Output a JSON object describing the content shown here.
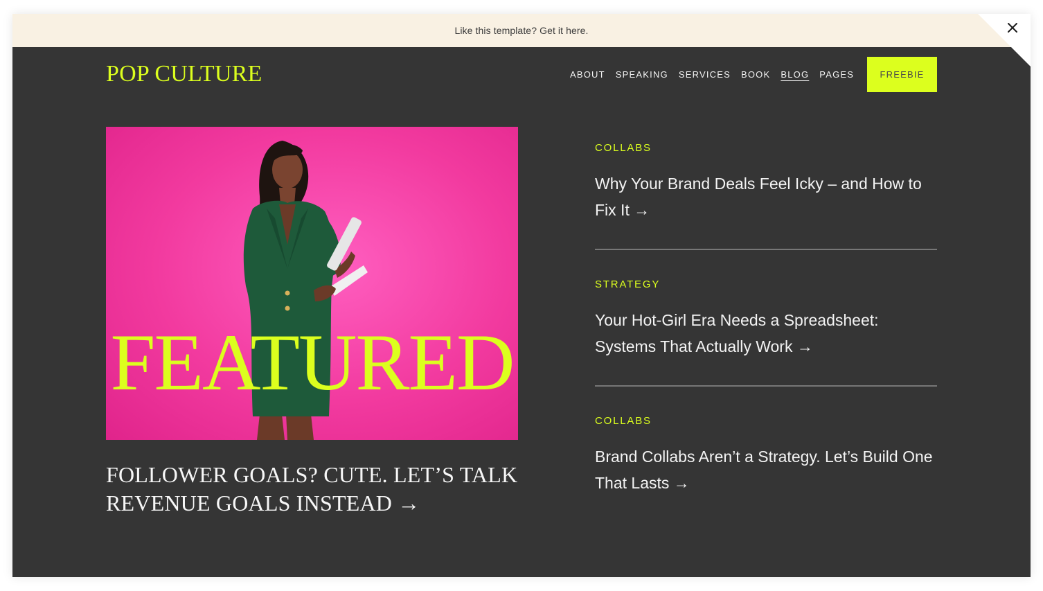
{
  "announcement": {
    "text": "Like this template? Get it here."
  },
  "site": {
    "logo": "POP CULTURE"
  },
  "nav": {
    "items": [
      {
        "label": "ABOUT"
      },
      {
        "label": "SPEAKING"
      },
      {
        "label": "SERVICES"
      },
      {
        "label": "BOOK"
      },
      {
        "label": "BLOG"
      },
      {
        "label": "PAGES"
      }
    ],
    "active": "BLOG",
    "cta_label": "FREEBIE"
  },
  "featured": {
    "overlay_word": "FEATURED",
    "title": "FOLLOWER GOALS? CUTE. LET’S TALK REVENUE GOALS INSTEAD →"
  },
  "posts": [
    {
      "category": "COLLABS",
      "title": "Why Your Brand Deals Feel Icky – and How to Fix It →"
    },
    {
      "category": "STRATEGY",
      "title": "Your Hot-Girl Era Needs a Spreadsheet: Systems That Actually Work →"
    },
    {
      "category": "COLLABS",
      "title": "Brand Collabs Aren’t a Strategy. Let’s Build One That Lasts →"
    }
  ],
  "colors": {
    "background": "#353535",
    "accent": "#dcff1e",
    "announcement_bg": "#f9f1e3",
    "featured_bg": "#f23a9f",
    "text": "#f3f3f3"
  },
  "icons": {
    "close": "close-icon"
  }
}
